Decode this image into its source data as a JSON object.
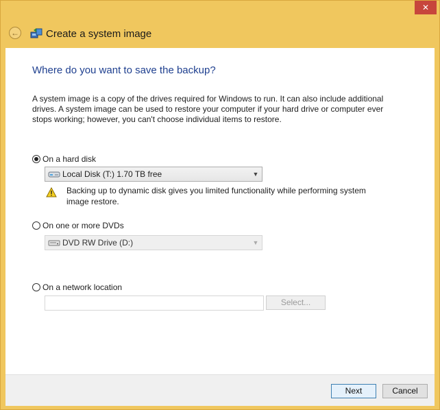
{
  "window": {
    "title": "Create a system image",
    "close_label": "✕"
  },
  "main": {
    "heading": "Where do you want to save the backup?",
    "description": "A system image is a copy of the drives required for Windows to run. It can also include additional drives. A system image can be used to restore your computer if your hard drive or computer ever stops working; however, you can't choose individual items to restore.",
    "options": {
      "hard_disk": {
        "label": "On a hard disk",
        "checked": true,
        "selected_drive": "Local Disk (T:)  1.70 TB free",
        "warning": "Backing up to dynamic disk gives you limited functionality while performing system image restore."
      },
      "dvd": {
        "label": "On one or more DVDs",
        "checked": false,
        "selected_drive": "DVD RW Drive (D:)"
      },
      "network": {
        "label": "On a network location",
        "checked": false,
        "path_value": "",
        "select_button": "Select..."
      }
    }
  },
  "footer": {
    "next_label": "Next",
    "cancel_label": "Cancel"
  },
  "icons": {
    "back": "back-arrow-icon",
    "title": "system-backup-icon",
    "hard_drive": "hard-drive-icon",
    "dvd_drive": "dvd-drive-icon",
    "warning": "warning-icon"
  },
  "colors": {
    "frame": "#f0c75e",
    "heading": "#1e3f8f",
    "close": "#c7463c"
  }
}
